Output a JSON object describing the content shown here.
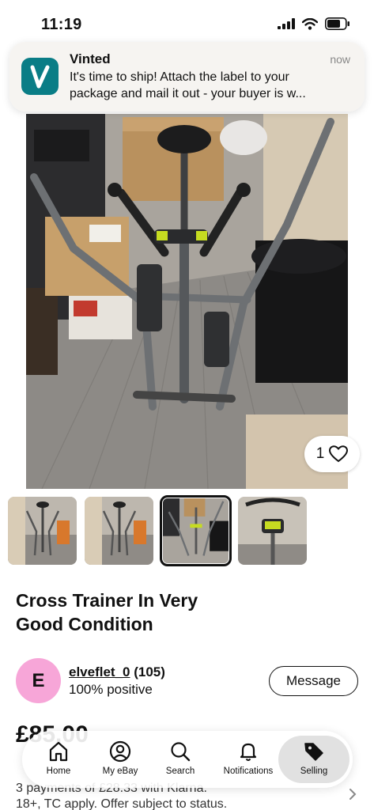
{
  "status_bar": {
    "time": "11:19"
  },
  "notification": {
    "app_name": "Vinted",
    "time": "now",
    "line1": "It's time to ship! Attach the label to your",
    "line2": "package and mail it out - your buyer is w..."
  },
  "listing": {
    "like_count": "1",
    "title_line1": "Cross Trainer In Very",
    "title_line2": "Good Condition",
    "price": "£85.00",
    "payments_line1": "3 payments of £28.33 with Klarna.",
    "payments_line2": "18+, TC apply. Offer subject to status.",
    "thumbnails": [
      {
        "name": "thumb-1",
        "selected": false
      },
      {
        "name": "thumb-2",
        "selected": false
      },
      {
        "name": "thumb-3",
        "selected": true
      },
      {
        "name": "thumb-4",
        "selected": false
      }
    ]
  },
  "seller": {
    "avatar_letter": "E",
    "name": "elveflet_0",
    "score": "(105)",
    "feedback": "100% positive",
    "message_label": "Message"
  },
  "tabbar": {
    "items": [
      {
        "label": "Home",
        "icon": "home-icon",
        "active": false
      },
      {
        "label": "My eBay",
        "icon": "profile-icon",
        "active": false
      },
      {
        "label": "Search",
        "icon": "search-icon",
        "active": false
      },
      {
        "label": "Notifications",
        "icon": "bell-icon",
        "active": false
      },
      {
        "label": "Selling",
        "icon": "tag-icon",
        "active": true
      }
    ]
  },
  "colors": {
    "avatar": "#f7a6d8",
    "vinted_icon": "#0a7d86",
    "active_tab": "#e1e1e1"
  }
}
